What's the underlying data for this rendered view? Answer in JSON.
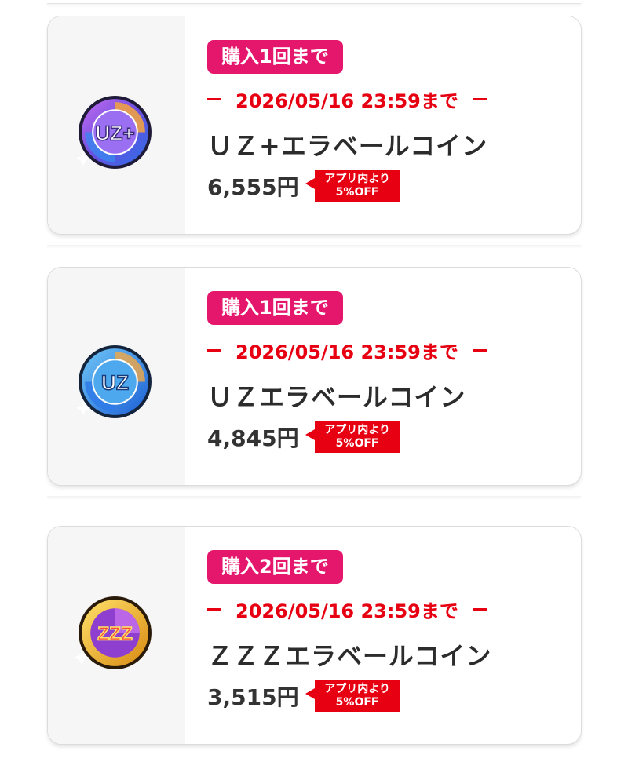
{
  "colors": {
    "badge_pink": "#e5176d",
    "deadline_red": "#e60012",
    "discount_red": "#e60012",
    "text_dark": "#2c2c2c"
  },
  "products": [
    {
      "limit": "購入1回まで",
      "deadline": "2026/05/16 23:59まで",
      "name": "ＵＺ+エラベールコイン",
      "price": "6,555円",
      "discount_line1": "アプリ内より",
      "discount_line2": "5%OFF",
      "coin_icon": "uz-plus-coin-icon",
      "coin_text": "UZ+"
    },
    {
      "limit": "購入1回まで",
      "deadline": "2026/05/16 23:59まで",
      "name": "ＵＺエラベールコイン",
      "price": "4,845円",
      "discount_line1": "アプリ内より",
      "discount_line2": "5%OFF",
      "coin_icon": "uz-coin-icon",
      "coin_text": "UZ"
    },
    {
      "limit": "購入2回まで",
      "deadline": "2026/05/16 23:59まで",
      "name": "ＺＺＺエラベールコイン",
      "price": "3,515円",
      "discount_line1": "アプリ内より",
      "discount_line2": "5%OFF",
      "coin_icon": "zzz-coin-icon",
      "coin_text": "ZZZ"
    }
  ]
}
